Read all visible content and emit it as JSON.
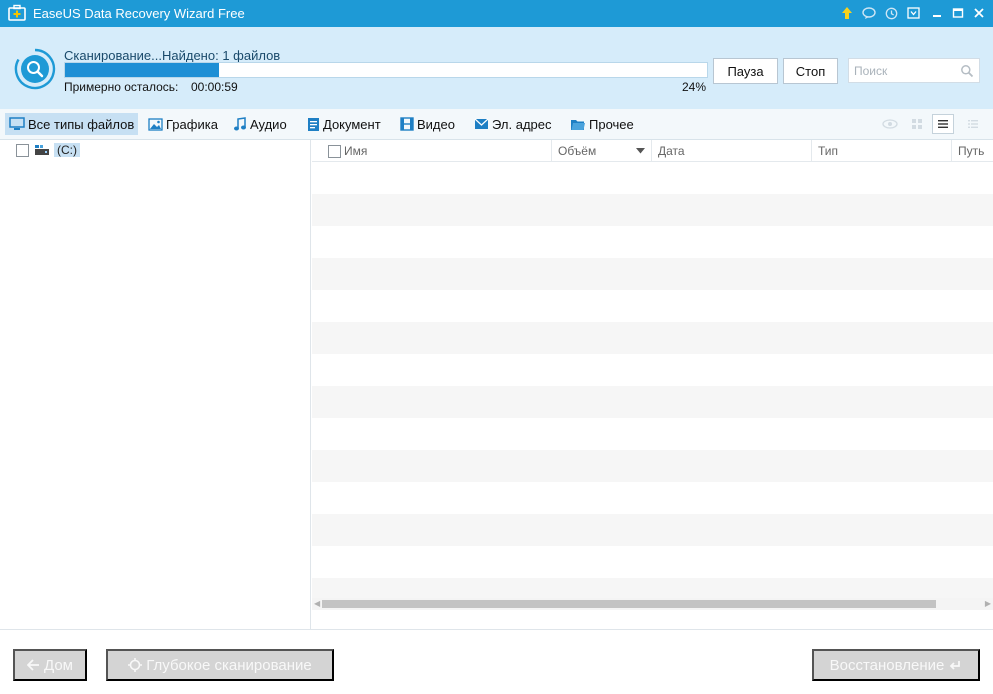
{
  "window": {
    "title": "EaseUS Data Recovery Wizard Free",
    "title_icons": [
      "upgrade-arrow-icon",
      "chat-icon",
      "history-icon",
      "menu-icon",
      "minimize-icon",
      "maximize-icon",
      "close-icon"
    ]
  },
  "scan": {
    "status": "Сканирование...Найдено: 1 файлов",
    "progress_percent": 24,
    "percent_label": "24%",
    "remaining_label": "Примерно осталось:",
    "remaining_time": "00:00:59",
    "pause_label": "Пауза",
    "stop_label": "Стоп",
    "search_placeholder": "Поиск"
  },
  "filters": [
    {
      "label": "Все типы файлов",
      "icon": "monitor-icon",
      "active": true
    },
    {
      "label": "Графика",
      "icon": "image-icon",
      "active": false
    },
    {
      "label": "Аудио",
      "icon": "music-note-icon",
      "active": false
    },
    {
      "label": "Документ",
      "icon": "document-icon",
      "active": false
    },
    {
      "label": "Видео",
      "icon": "film-icon",
      "active": false
    },
    {
      "label": "Эл. адрес",
      "icon": "envelope-icon",
      "active": false
    },
    {
      "label": "Прочее",
      "icon": "folder-icon",
      "active": false
    }
  ],
  "view_modes": [
    "preview-eye-icon",
    "grid-view-icon",
    "list-view-icon",
    "detail-view-icon"
  ],
  "tree": {
    "root_label": "(C:)"
  },
  "columns": [
    {
      "label": "Имя"
    },
    {
      "label": "Объём"
    },
    {
      "label": "Дата"
    },
    {
      "label": "Тип"
    },
    {
      "label": "Путь"
    }
  ],
  "bottom": {
    "home_label": "Дом",
    "deep_scan_label": "Глубокое сканирование",
    "recover_label": "Восстановление"
  },
  "colors": {
    "titlebar": "#1e9ad6",
    "scan_panel": "#d6ecfa",
    "progress_fill": "#1e8fd5",
    "active_tab": "#c7e0f3",
    "disabled_button": "#d4d4d4"
  }
}
